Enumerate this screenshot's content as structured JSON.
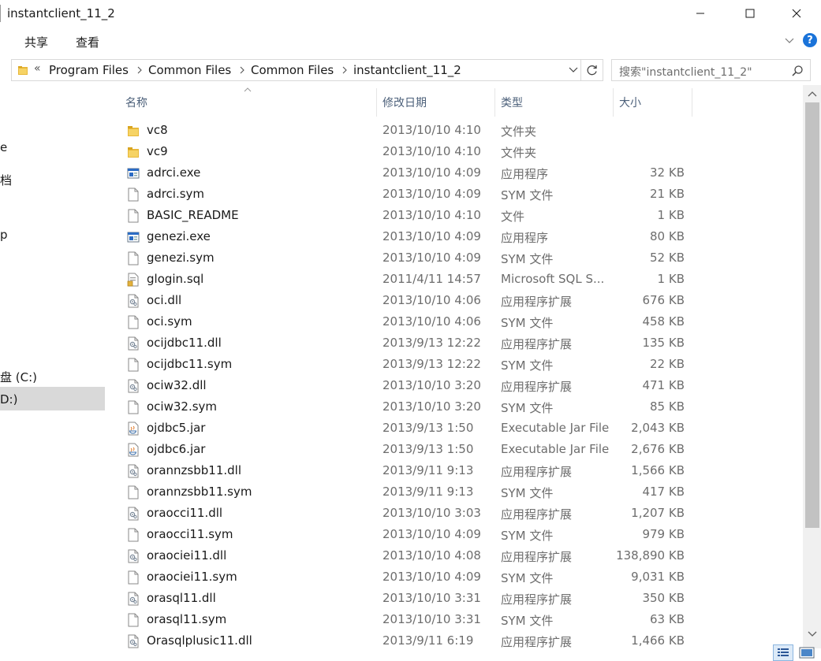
{
  "window": {
    "title": "instantclient_11_2",
    "controls": {
      "minimize": "minimize-icon",
      "maximize": "maximize-icon",
      "close": "close-icon"
    }
  },
  "ribbon": {
    "tabs": [
      {
        "label": "共享"
      },
      {
        "label": "查看"
      }
    ],
    "help": "?"
  },
  "address": {
    "overflow": "«",
    "crumbs": [
      {
        "label": "Program Files"
      },
      {
        "label": "Common Files"
      },
      {
        "label": "Common Files"
      },
      {
        "label": "instantclient_11_2"
      }
    ]
  },
  "search": {
    "placeholder": "搜索\"instantclient_11_2\""
  },
  "nav": {
    "items": [
      {
        "label": "e"
      },
      {
        "label": "档"
      },
      {
        "label": "p"
      },
      {
        "label": "盘 (C:)"
      },
      {
        "label": "D:)"
      }
    ]
  },
  "columns": {
    "name": "名称",
    "date": "修改日期",
    "type": "类型",
    "size": "大小"
  },
  "files": [
    {
      "name": "vc8",
      "date": "2013/10/10 4:10",
      "type": "文件夹",
      "size": "",
      "icon": "folder-icon"
    },
    {
      "name": "vc9",
      "date": "2013/10/10 4:10",
      "type": "文件夹",
      "size": "",
      "icon": "folder-icon"
    },
    {
      "name": "adrci.exe",
      "date": "2013/10/10 4:09",
      "type": "应用程序",
      "size": "32 KB",
      "icon": "exe-icon"
    },
    {
      "name": "adrci.sym",
      "date": "2013/10/10 4:09",
      "type": "SYM 文件",
      "size": "21 KB",
      "icon": "file-icon"
    },
    {
      "name": "BASIC_README",
      "date": "2013/10/10 4:10",
      "type": "文件",
      "size": "1 KB",
      "icon": "file-icon"
    },
    {
      "name": "genezi.exe",
      "date": "2013/10/10 4:09",
      "type": "应用程序",
      "size": "80 KB",
      "icon": "exe-icon"
    },
    {
      "name": "genezi.sym",
      "date": "2013/10/10 4:09",
      "type": "SYM 文件",
      "size": "52 KB",
      "icon": "file-icon"
    },
    {
      "name": "glogin.sql",
      "date": "2011/4/11 14:57",
      "type": "Microsoft SQL S...",
      "size": "1 KB",
      "icon": "sql-file-icon"
    },
    {
      "name": "oci.dll",
      "date": "2013/10/10 4:06",
      "type": "应用程序扩展",
      "size": "676 KB",
      "icon": "dll-icon"
    },
    {
      "name": "oci.sym",
      "date": "2013/10/10 4:06",
      "type": "SYM 文件",
      "size": "458 KB",
      "icon": "file-icon"
    },
    {
      "name": "ocijdbc11.dll",
      "date": "2013/9/13 12:22",
      "type": "应用程序扩展",
      "size": "135 KB",
      "icon": "dll-icon"
    },
    {
      "name": "ocijdbc11.sym",
      "date": "2013/9/13 12:22",
      "type": "SYM 文件",
      "size": "22 KB",
      "icon": "file-icon"
    },
    {
      "name": "ociw32.dll",
      "date": "2013/10/10 3:20",
      "type": "应用程序扩展",
      "size": "471 KB",
      "icon": "dll-icon"
    },
    {
      "name": "ociw32.sym",
      "date": "2013/10/10 3:20",
      "type": "SYM 文件",
      "size": "85 KB",
      "icon": "file-icon"
    },
    {
      "name": "ojdbc5.jar",
      "date": "2013/9/13 1:50",
      "type": "Executable Jar File",
      "size": "2,043 KB",
      "icon": "jar-icon"
    },
    {
      "name": "ojdbc6.jar",
      "date": "2013/9/13 1:50",
      "type": "Executable Jar File",
      "size": "2,676 KB",
      "icon": "jar-icon"
    },
    {
      "name": "orannzsbb11.dll",
      "date": "2013/9/11 9:13",
      "type": "应用程序扩展",
      "size": "1,566 KB",
      "icon": "dll-icon"
    },
    {
      "name": "orannzsbb11.sym",
      "date": "2013/9/11 9:13",
      "type": "SYM 文件",
      "size": "417 KB",
      "icon": "file-icon"
    },
    {
      "name": "oraocci11.dll",
      "date": "2013/10/10 3:03",
      "type": "应用程序扩展",
      "size": "1,207 KB",
      "icon": "dll-icon"
    },
    {
      "name": "oraocci11.sym",
      "date": "2013/10/10 4:09",
      "type": "SYM 文件",
      "size": "979 KB",
      "icon": "file-icon"
    },
    {
      "name": "oraociei11.dll",
      "date": "2013/10/10 4:08",
      "type": "应用程序扩展",
      "size": "138,890 KB",
      "icon": "dll-icon"
    },
    {
      "name": "oraociei11.sym",
      "date": "2013/10/10 4:09",
      "type": "SYM 文件",
      "size": "9,031 KB",
      "icon": "file-icon"
    },
    {
      "name": "orasql11.dll",
      "date": "2013/10/10 3:31",
      "type": "应用程序扩展",
      "size": "350 KB",
      "icon": "dll-icon"
    },
    {
      "name": "orasql11.sym",
      "date": "2013/10/10 3:31",
      "type": "SYM 文件",
      "size": "63 KB",
      "icon": "file-icon"
    },
    {
      "name": "Orasqlplusic11.dll",
      "date": "2013/9/11 6:19",
      "type": "应用程序扩展",
      "size": "1,466 KB",
      "icon": "dll-icon"
    }
  ],
  "view": {
    "details": "details-view-icon",
    "large": "large-icons-view-icon"
  }
}
